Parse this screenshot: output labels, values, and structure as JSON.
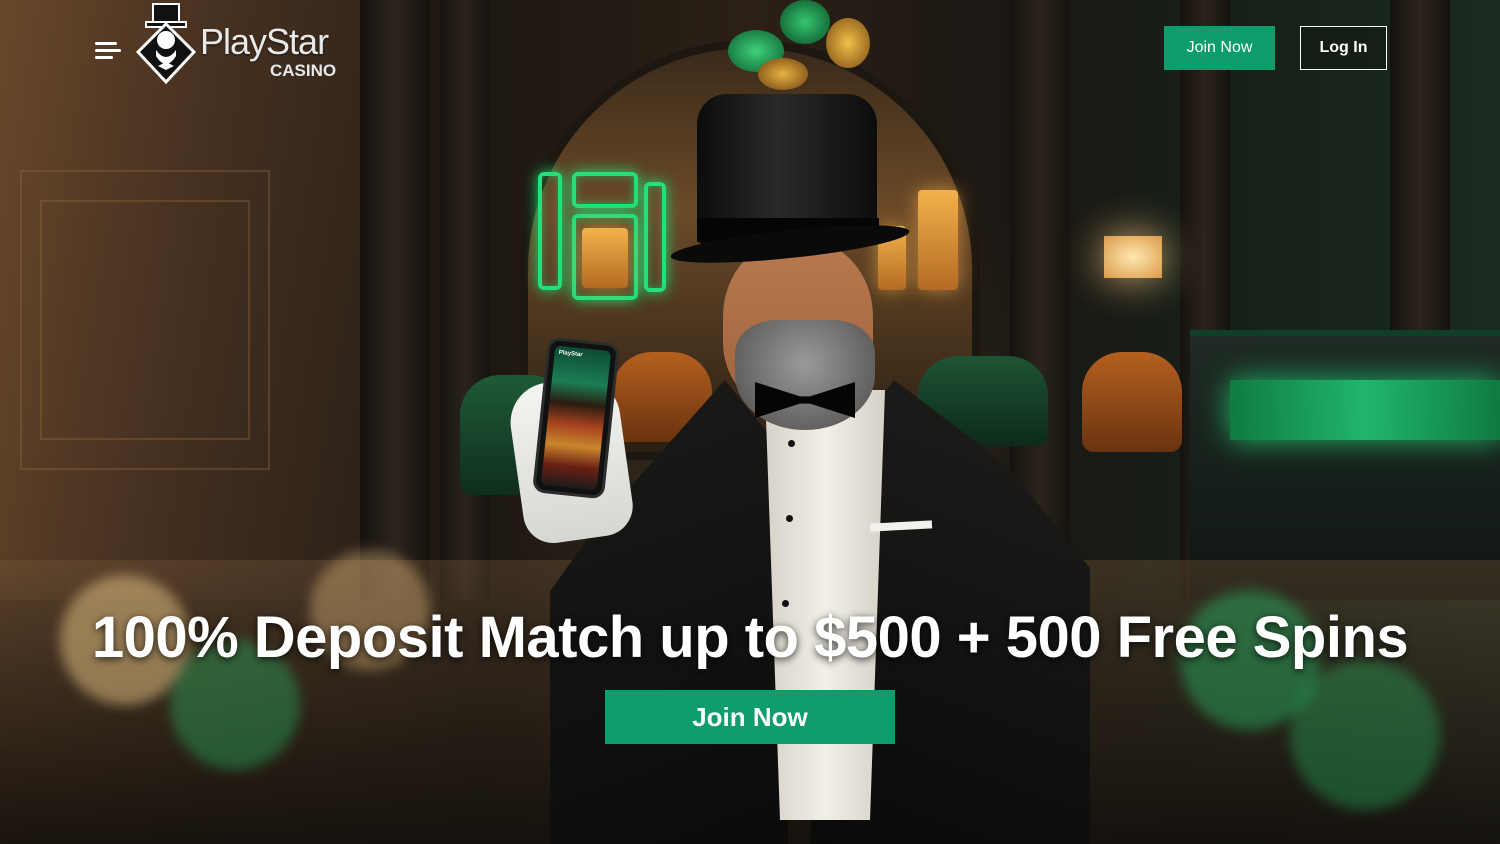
{
  "brand": {
    "name": "PlayStar",
    "subtitle": "CASINO"
  },
  "header": {
    "menu_icon": "hamburger-menu-icon",
    "join_label": "Join Now",
    "login_label": "Log In"
  },
  "promo": {
    "headline": "100% Deposit Match up to $500 + 500 Free Spins",
    "cta_label": "Join Now"
  },
  "phone": {
    "logo_text": "PlayStar"
  },
  "colors": {
    "accent": "#0d9c6c",
    "text": "#ffffff"
  }
}
